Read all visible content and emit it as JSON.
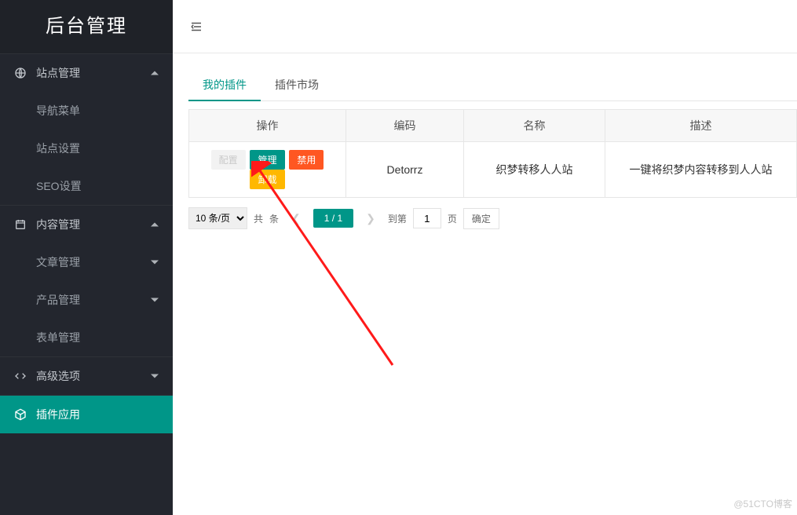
{
  "logo": "后台管理",
  "sidebar": {
    "site": {
      "label": "站点管理",
      "items": [
        {
          "label": "导航菜单"
        },
        {
          "label": "站点设置"
        },
        {
          "label": "SEO设置"
        }
      ]
    },
    "content": {
      "label": "内容管理",
      "items": [
        {
          "label": "文章管理"
        },
        {
          "label": "产品管理"
        },
        {
          "label": "表单管理"
        }
      ]
    },
    "advanced": {
      "label": "高级选项"
    },
    "plugins": {
      "label": "插件应用"
    }
  },
  "tabs": {
    "my_plugins": "我的插件",
    "plugin_market": "插件市场"
  },
  "table": {
    "headers": {
      "action": "操作",
      "code": "编码",
      "name": "名称",
      "desc": "描述"
    },
    "row": {
      "btn_config": "配置",
      "btn_manage": "管理",
      "btn_disable": "禁用",
      "btn_uninstall": "卸载",
      "code": "Detorrz",
      "name": "织梦转移人人站",
      "desc": "一键将织梦内容转移到人人站"
    }
  },
  "pager": {
    "page_size": "10 条/页",
    "total_prefix": "共",
    "total_suffix": "条",
    "current": "1 / 1",
    "goto_prefix": "到第",
    "goto_value": "1",
    "goto_suffix": "页",
    "confirm": "确定"
  },
  "watermark": "@51CTO博客"
}
